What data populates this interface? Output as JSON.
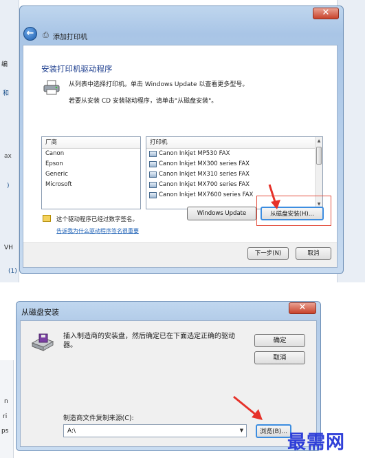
{
  "background": {
    "frag_top": "编",
    "frag_he": "和",
    "frag_ax": "ax",
    "frag_paren": ")",
    "frag_vh": "VH",
    "frag_count": "(1)",
    "frag_bottom": [
      "n",
      "ri",
      "ps"
    ]
  },
  "add_printer_window": {
    "close_glyph": "✕",
    "title": "添加打印机",
    "heading": "安装打印机驱动程序",
    "instruction_1": "从列表中选择打印机。单击 Windows Update 以查看更多型号。",
    "instruction_2": "若要从安装 CD 安装驱动程序，请单击\"从磁盘安装\"。",
    "manufacturer_header": "厂商",
    "manufacturers": [
      "Canon",
      "Epson",
      "Generic",
      "Microsoft"
    ],
    "printer_header": "打印机",
    "printers": [
      "Canon Inkjet MP530 FAX",
      "Canon Inkjet MX300 series FAX",
      "Canon Inkjet MX310 series FAX",
      "Canon Inkjet MX700 series FAX",
      "Canon Inkjet MX7600 series FAX"
    ],
    "signed_text": "这个驱动程序已经过数字签名。",
    "signed_link": "告诉我为什么驱动程序签名很重要",
    "windows_update_button": "Windows Update",
    "have_disk_button": "从磁盘安装(H)...",
    "next_button": "下一步(N)",
    "cancel_button": "取消"
  },
  "install_from_disk_dialog": {
    "title": "从磁盘安装",
    "close_glyph": "✕",
    "message": "插入制造商的安装盘，然后确定已在下面选定正确的驱动器。",
    "ok_button": "确定",
    "cancel_button": "取消",
    "source_label": "制造商文件复制来源(C):",
    "source_value": "A:\\",
    "browse_button": "浏览(B)..."
  },
  "watermark": "最需网",
  "colors": {
    "heading_blue": "#1e3f8f",
    "link_blue": "#1b5fb5",
    "highlight_red": "#e34c3c",
    "focus_blue": "#3c8de0",
    "watermark_blue": "#2f3fd8"
  }
}
